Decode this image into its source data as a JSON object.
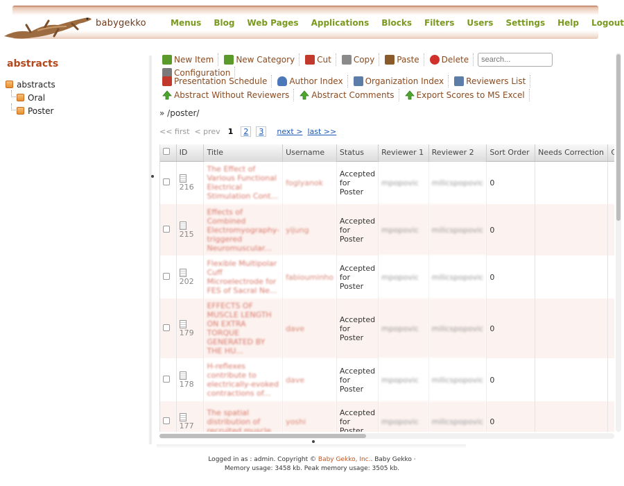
{
  "app": {
    "title": "babygekko"
  },
  "topnav": [
    "Menus",
    "Blog",
    "Web Pages",
    "Applications",
    "Blocks",
    "Filters",
    "Users",
    "Settings",
    "Help",
    "Logout"
  ],
  "sidebar": {
    "title": "abstracts",
    "root": "abstracts",
    "children": [
      "Oral",
      "Poster"
    ]
  },
  "toolbar": {
    "row1": [
      {
        "label": "New Item",
        "icon": "new-item-icon",
        "color": "#5a9a2a"
      },
      {
        "label": "New Category",
        "icon": "new-category-icon",
        "color": "#5a9a2a"
      },
      {
        "label": "Cut",
        "icon": "scissors-icon",
        "color": "#c0392b"
      },
      {
        "label": "Copy",
        "icon": "copy-icon",
        "color": "#8a8a8a"
      },
      {
        "label": "Paste",
        "icon": "paste-icon",
        "color": "#8b5a2b"
      },
      {
        "label": "Delete",
        "icon": "delete-icon",
        "color": "#d0312d"
      }
    ],
    "search_placeholder": "search...",
    "configuration": {
      "label": "Configuration",
      "icon": "tools-icon",
      "color": "#7a7a7a"
    },
    "row2": [
      {
        "label": "Presentation Schedule",
        "icon": "calendar-icon",
        "color": "#c0392b"
      },
      {
        "label": "Author Index",
        "icon": "user-icon",
        "color": "#4a78b8"
      },
      {
        "label": "Organization Index",
        "icon": "card-icon",
        "color": "#5b7da8"
      },
      {
        "label": "Reviewers List",
        "icon": "card-icon",
        "color": "#5b7da8"
      },
      {
        "label": "Abstract Without Reviewers",
        "icon": "up-arrow-icon",
        "color": "#4ea62d"
      },
      {
        "label": "Abstract Comments",
        "icon": "up-arrow-icon",
        "color": "#4ea62d"
      },
      {
        "label": "Export Scores to MS Excel",
        "icon": "up-arrow-icon",
        "color": "#4ea62d"
      }
    ]
  },
  "breadcrumb": "» /poster/",
  "pager": {
    "first": "<< first",
    "prev": "< prev",
    "current": "1",
    "pages": [
      "2",
      "3"
    ],
    "next": "next >",
    "last": "last >>"
  },
  "table": {
    "columns": [
      "ID",
      "Title",
      "Username",
      "Status",
      "Reviewer 1",
      "Reviewer 2",
      "Sort Order",
      "Needs Correction",
      "Co"
    ],
    "rows": [
      {
        "id": "216",
        "title": "The Effect of Various Functional Electrical Stimulation Cont...",
        "username": "foglyanok",
        "status": "Accepted for Poster",
        "reviewer1": "mpopovic",
        "reviewer2": "milicspopovic",
        "sort_order": "0"
      },
      {
        "id": "215",
        "title": "Effects of Combined Electromyography-triggered Neuromuscular...",
        "username": "yijung",
        "status": "Accepted for Poster",
        "reviewer1": "mpopovic",
        "reviewer2": "milicspopovic",
        "sort_order": "0"
      },
      {
        "id": "202",
        "title": "Flexible Multipolar Cuff Microelectrode for FES of Sacral Ne...",
        "username": "fabiouminho",
        "status": "Accepted for Poster",
        "reviewer1": "mpopovic",
        "reviewer2": "milicspopovic",
        "sort_order": "0"
      },
      {
        "id": "179",
        "title": "EFFECTS OF MUSCLE LENGTH ON EXTRA TORQUE GENERATED BY THE HU...",
        "username": "dave",
        "status": "Accepted for Poster",
        "reviewer1": "mpopovic",
        "reviewer2": "milicspopovic",
        "sort_order": "0"
      },
      {
        "id": "178",
        "title": "H-reflexes contribute to electrically-evoked contractions of...",
        "username": "dave",
        "status": "Accepted for Poster",
        "reviewer1": "mpopovic",
        "reviewer2": "milicspopovic",
        "sort_order": "0"
      },
      {
        "id": "177",
        "title": "The spatial distribution of recruited muscle",
        "username": "yoshi",
        "status": "Accepted for Poster",
        "reviewer1": "mpopovic",
        "reviewer2": "milicspopovic",
        "sort_order": "0"
      }
    ]
  },
  "footer": {
    "logged_in_prefix": "Logged in as : admin. Copyright ©",
    "company_link": "Baby Gekko, Inc.",
    "suffix": ". Baby Gekko ·",
    "memory": "Memory usage: 3458 kb. Peak memory usage: 3505 kb."
  }
}
